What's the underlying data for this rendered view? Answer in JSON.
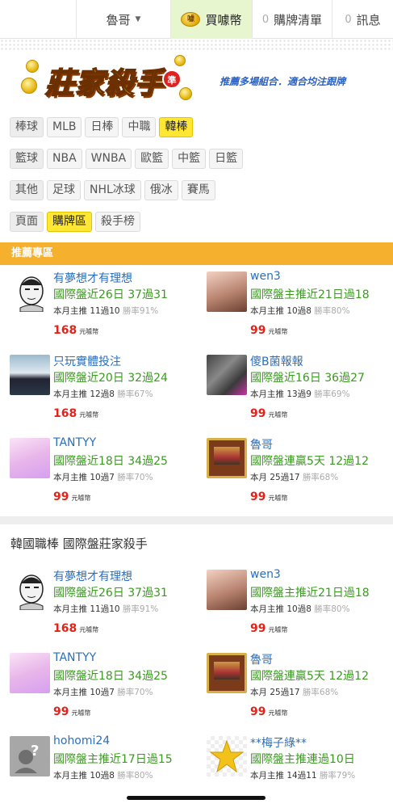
{
  "topbar": {
    "user": "魯哥",
    "buy": "買噱幣",
    "list_count": "0",
    "list_label": "購牌清單",
    "msg_count": "0",
    "msg_label": "訊息",
    "coin_icon": "coin-icon"
  },
  "banner": {
    "logo_text": "莊家殺手",
    "logo_badge": "準",
    "slogan": "推薦多場組合．適合均注跟牌"
  },
  "filters": [
    {
      "category": "棒球",
      "items": [
        "MLB",
        "日棒",
        "中職",
        "韓棒"
      ],
      "active": "韓棒"
    },
    {
      "category": "籃球",
      "items": [
        "NBA",
        "WNBA",
        "歐籃",
        "中籃",
        "日籃"
      ],
      "active": ""
    },
    {
      "category": "其他",
      "items": [
        "足球",
        "NHL冰球",
        "俄冰",
        "賽馬"
      ],
      "active": ""
    },
    {
      "category": "頁面",
      "items": [
        "購牌區",
        "殺手榜"
      ],
      "active": "購牌區"
    }
  ],
  "colors": {
    "accent": "#f5b12e",
    "active_chip": "#ffe733",
    "price": "#e2231a",
    "name": "#2a6fbd",
    "record": "#3a9a1f"
  },
  "section1": {
    "title": "推薦專區",
    "cards": [
      {
        "name": "有夢想才有理想",
        "record": "國際盤近26日 37過31",
        "month": "本月主推 11過10",
        "win": "勝率91%",
        "price": "168",
        "unit": "元噱幣",
        "avatar": "face"
      },
      {
        "name": "wen3",
        "record": "國際盤主推近21日過18",
        "month": "本月主推 10過8",
        "win": "勝率80%",
        "price": "99",
        "unit": "元噱幣",
        "avatar": "girl"
      },
      {
        "name": "只玩實體投注",
        "record": "國際盤近20日 32過24",
        "month": "本月主推 12過8",
        "win": "勝率67%",
        "price": "168",
        "unit": "元噱幣",
        "avatar": "lake"
      },
      {
        "name": "傻B菌報報",
        "record": "國際盤近16日 36過27",
        "month": "本月主推 13過9",
        "win": "勝率69%",
        "price": "99",
        "unit": "元噱幣",
        "avatar": "cat"
      },
      {
        "name": "TANTYY",
        "record": "國際盤近18日 34過25",
        "month": "本月主推 10過7",
        "win": "勝率70%",
        "price": "99",
        "unit": "元噱幣",
        "avatar": "pink"
      },
      {
        "name": "魯哥",
        "record": "國際盤連贏5天 12過12",
        "month": "本月 25過17",
        "win": "勝率68%",
        "price": "99",
        "unit": "元噱幣",
        "avatar": "card"
      }
    ]
  },
  "section2": {
    "title": "韓國職棒 國際盤莊家殺手",
    "cards": [
      {
        "name": "有夢想才有理想",
        "record": "國際盤近26日 37過31",
        "month": "本月主推 11過10",
        "win": "勝率91%",
        "price": "168",
        "unit": "元噱幣",
        "avatar": "face"
      },
      {
        "name": "wen3",
        "record": "國際盤主推近21日過18",
        "month": "本月主推 10過8",
        "win": "勝率80%",
        "price": "99",
        "unit": "元噱幣",
        "avatar": "girl"
      },
      {
        "name": "TANTYY",
        "record": "國際盤近18日 34過25",
        "month": "本月主推 10過7",
        "win": "勝率70%",
        "price": "99",
        "unit": "元噱幣",
        "avatar": "pink"
      },
      {
        "name": "魯哥",
        "record": "國際盤連贏5天 12過12",
        "month": "本月 25過17",
        "win": "勝率68%",
        "price": "99",
        "unit": "元噱幣",
        "avatar": "card"
      },
      {
        "name": "hohomi24",
        "record": "國際盤主推近17日過15",
        "month": "本月主推 10過8",
        "win": "勝率80%",
        "price": "",
        "unit": "",
        "avatar": "default"
      },
      {
        "name": "**梅子綠**",
        "record": "國際盤主推連過10日",
        "month": "本月主推 14過11",
        "win": "勝率79%",
        "price": "",
        "unit": "",
        "avatar": "star"
      }
    ]
  }
}
